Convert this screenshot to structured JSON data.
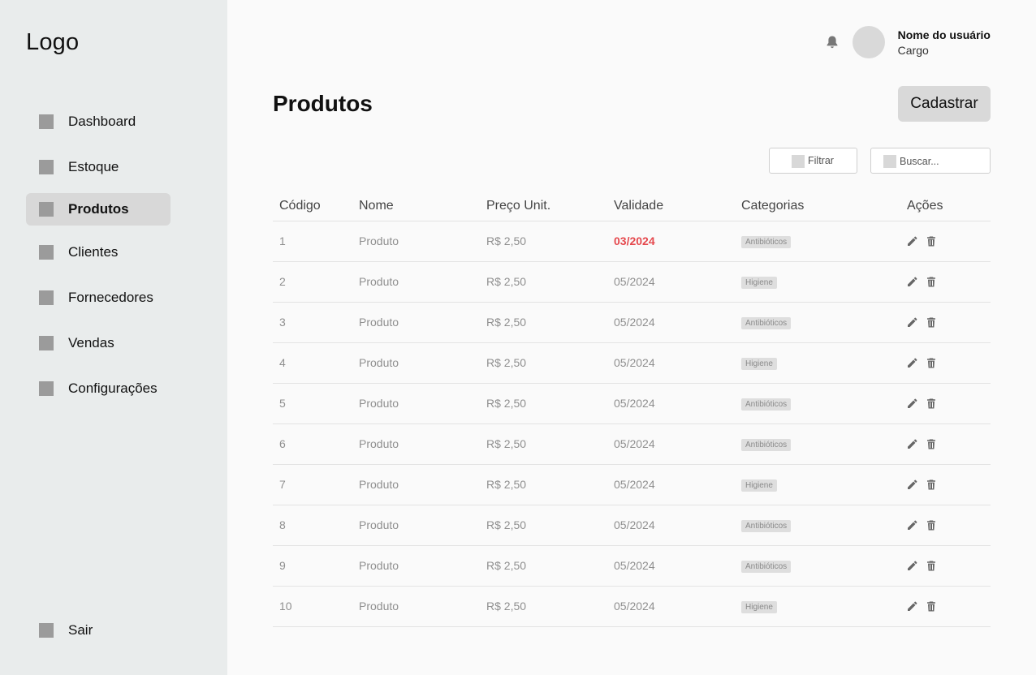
{
  "logo": "Logo",
  "nav": {
    "items": [
      {
        "label": "Dashboard"
      },
      {
        "label": "Estoque"
      },
      {
        "label": "Produtos"
      },
      {
        "label": "Clientes"
      },
      {
        "label": "Fornecedores"
      },
      {
        "label": "Vendas"
      },
      {
        "label": "Configurações"
      }
    ],
    "logout": "Sair"
  },
  "user": {
    "name": "Nome do usuário",
    "role": "Cargo"
  },
  "page": {
    "title": "Produtos",
    "primary_button": "Cadastrar"
  },
  "toolbar": {
    "filter_label": "Filtrar",
    "search_placeholder": "Buscar..."
  },
  "table": {
    "headers": [
      "Código",
      "Nome",
      "Preço Unit.",
      "Validade",
      "Categorias",
      "Ações"
    ],
    "rows": [
      [
        "1",
        "Produto",
        "R$ 2,50",
        "03/2024",
        "Antibióticos"
      ],
      [
        "2",
        "Produto",
        "R$ 2,50",
        "05/2024",
        "Higiene"
      ],
      [
        "3",
        "Produto",
        "R$ 2,50",
        "05/2024",
        "Antibióticos"
      ],
      [
        "4",
        "Produto",
        "R$ 2,50",
        "05/2024",
        "Higiene"
      ],
      [
        "5",
        "Produto",
        "R$ 2,50",
        "05/2024",
        "Antibióticos"
      ],
      [
        "6",
        "Produto",
        "R$ 2,50",
        "05/2024",
        "Antibióticos"
      ],
      [
        "7",
        "Produto",
        "R$ 2,50",
        "05/2024",
        "Higiene"
      ],
      [
        "8",
        "Produto",
        "R$ 2,50",
        "05/2024",
        "Antibióticos"
      ],
      [
        "9",
        "Produto",
        "R$ 2,50",
        "05/2024",
        "Antibióticos"
      ],
      [
        "10",
        "Produto",
        "R$ 2,50",
        "05/2024",
        "Higiene"
      ]
    ]
  },
  "colors": {
    "expired": "#e5484d",
    "sidebar_bg": "#e9ecec",
    "active_item_bg": "#d8d8d8"
  },
  "icons": {
    "notification": "bell-icon",
    "edit": "pencil-icon",
    "delete": "trash-icon"
  }
}
